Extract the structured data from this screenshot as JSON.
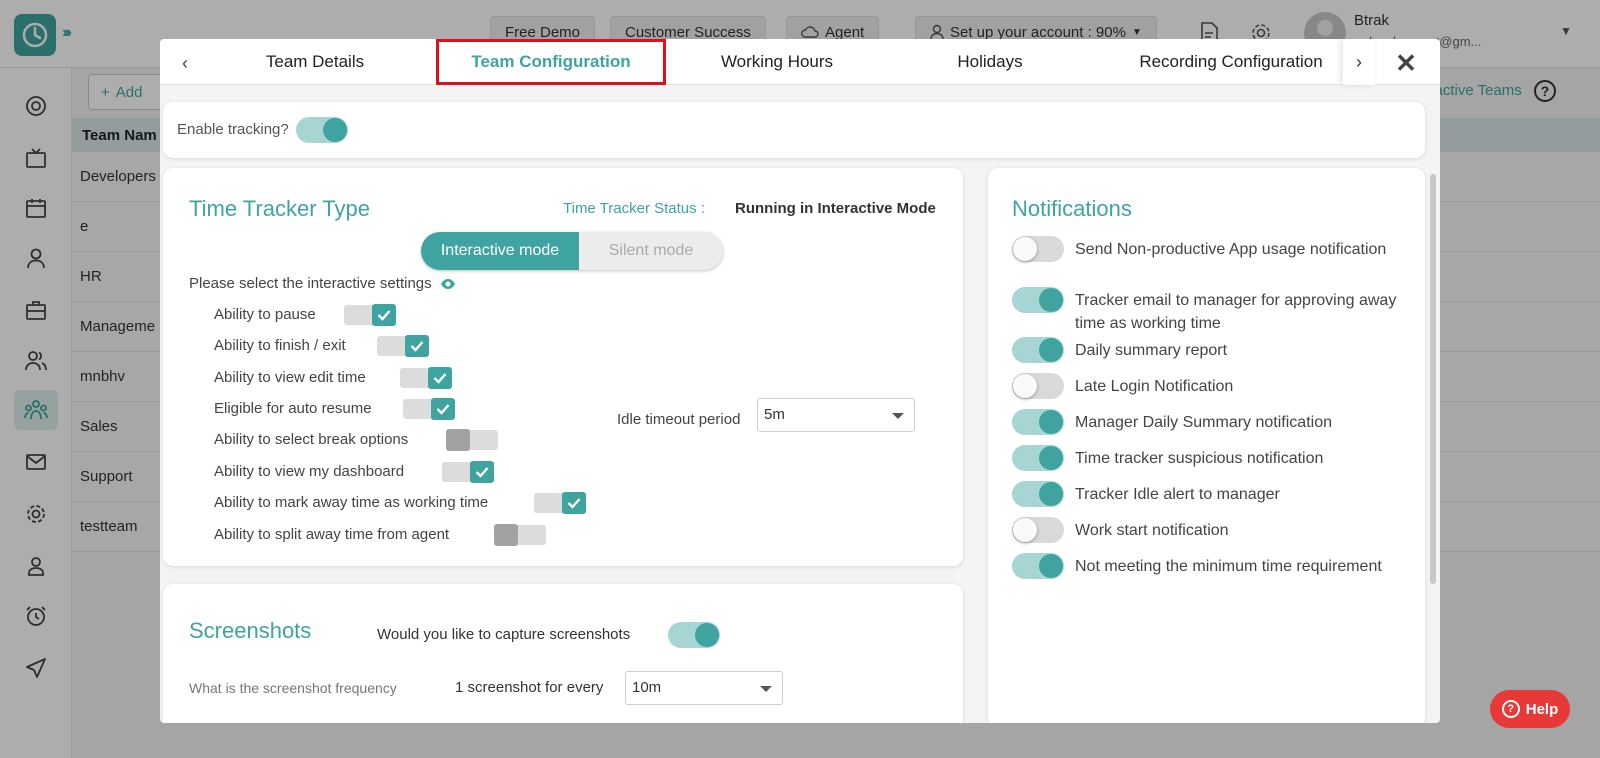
{
  "topbar": {
    "free_demo": "Free Demo",
    "customer_success": "Customer Success",
    "agent": "Agent",
    "setup": "Set up your account : 90%",
    "user_name": "Btrak",
    "user_email": "...development@gm..."
  },
  "background": {
    "add_label": "Add",
    "inactive_link": "Inactive Teams",
    "table_header": "Team Nam",
    "rows": [
      "Developers",
      "e",
      "HR",
      "Manageme",
      "mnbhv",
      "Sales",
      "Support",
      "testteam"
    ]
  },
  "tabs": [
    "Team Details",
    "Team Configuration",
    "Working Hours",
    "Holidays",
    "Recording Configuration"
  ],
  "active_tab": "Team Configuration",
  "enable_tracking": {
    "label": "Enable tracking?",
    "on": true
  },
  "tracker": {
    "title": "Time Tracker Type",
    "status_label": "Time Tracker Status :",
    "status_value": "Running in Interactive Mode",
    "modes": [
      "Interactive mode",
      "Silent mode"
    ],
    "active_mode": "Interactive mode",
    "settings_heading": "Please select the interactive settings",
    "settings": [
      {
        "label": "Ability to pause",
        "checked": true
      },
      {
        "label": "Ability to finish / exit",
        "checked": true
      },
      {
        "label": "Ability to view edit time",
        "checked": true
      },
      {
        "label": "Eligible for auto resume",
        "checked": true
      },
      {
        "label": "Ability to select break options",
        "checked": false
      },
      {
        "label": "Ability to view my dashboard",
        "checked": true
      },
      {
        "label": "Ability to mark away time as working time",
        "checked": true
      },
      {
        "label": "Ability to split away time from agent",
        "checked": false
      }
    ],
    "idle_label": "Idle timeout period",
    "idle_value": "5m"
  },
  "screenshots": {
    "title": "Screenshots",
    "question": "Would you like to capture screenshots",
    "enabled": true,
    "freq_label": "What is the screenshot frequency",
    "every_label": "1 screenshot for every",
    "freq_value": "10m"
  },
  "notifications": {
    "title": "Notifications",
    "items": [
      {
        "label": "Send Non-productive App usage notification",
        "on": false
      },
      {
        "label": "Tracker email to manager for approving away time as working time",
        "on": true
      },
      {
        "label": "Daily summary report",
        "on": true
      },
      {
        "label": "Late Login Notification",
        "on": false
      },
      {
        "label": "Manager Daily Summary notification",
        "on": true
      },
      {
        "label": "Time tracker suspicious notification",
        "on": true
      },
      {
        "label": "Tracker Idle alert to manager",
        "on": true
      },
      {
        "label": "Work start notification",
        "on": false
      },
      {
        "label": "Not meeting the minimum time requirement",
        "on": true
      }
    ]
  },
  "help_label": "Help",
  "colors": {
    "accent": "#3fa4a0",
    "highlight": "#e0101a",
    "help": "#e83838"
  }
}
